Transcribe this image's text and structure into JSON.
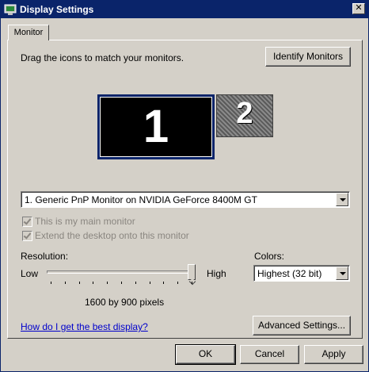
{
  "window": {
    "title": "Display Settings"
  },
  "tabs": [
    {
      "label": "Monitor"
    }
  ],
  "instructions": "Drag the icons to match your monitors.",
  "buttons": {
    "identify": "Identify Monitors",
    "advanced": "Advanced Settings...",
    "ok": "OK",
    "cancel": "Cancel",
    "apply": "Apply"
  },
  "monitors": [
    {
      "number": "1"
    },
    {
      "number": "2"
    }
  ],
  "monitor_select": {
    "selected": "1. Generic PnP Monitor on NVIDIA GeForce 8400M GT"
  },
  "checkboxes": {
    "main_monitor": {
      "label": "This is my main monitor",
      "checked": true,
      "enabled": false
    },
    "extend_desktop": {
      "label": "Extend the desktop onto this monitor",
      "checked": true,
      "enabled": false
    }
  },
  "resolution": {
    "label": "Resolution:",
    "low": "Low",
    "high": "High",
    "value_text": "1600 by 900 pixels",
    "slider_fraction": 1.0
  },
  "colors": {
    "label": "Colors:",
    "selected": "Highest (32 bit)"
  },
  "help_link": "How do I get the best display?",
  "theme": {
    "titlebar": "#0a246a",
    "face": "#d4d0c8",
    "link": "#0000cc"
  }
}
